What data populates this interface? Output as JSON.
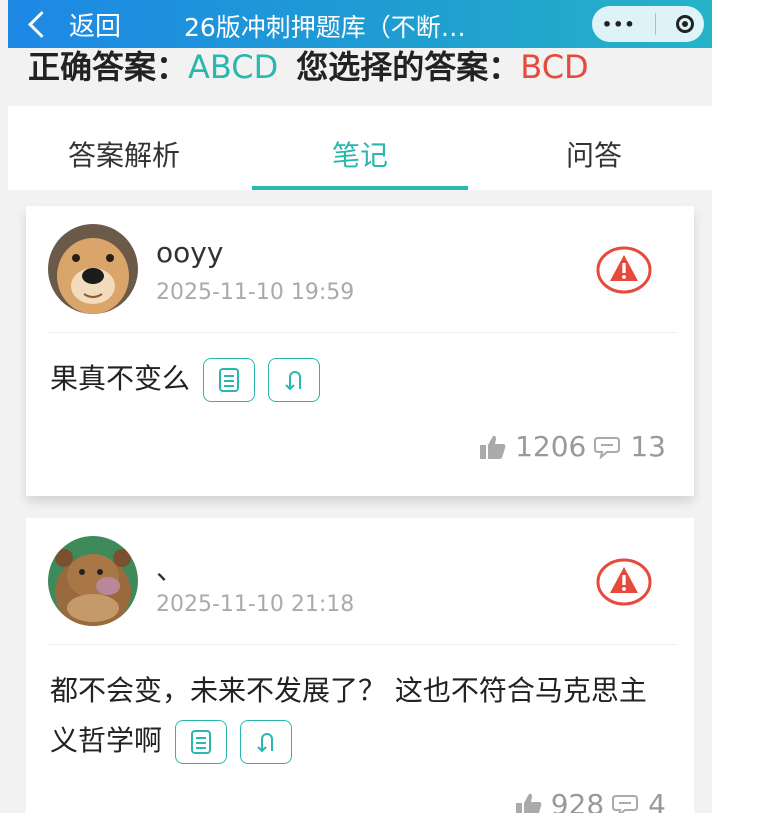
{
  "header": {
    "back_label": "返回",
    "title": "26版冲刺押题库（不断…"
  },
  "answer": {
    "correct_label": "正确答案：",
    "correct_value": "ABCD",
    "chosen_label": "您选择的答案：",
    "chosen_value": "BCD"
  },
  "tabs": [
    {
      "label": "答案解析",
      "active": false
    },
    {
      "label": "笔记",
      "active": true
    },
    {
      "label": "问答",
      "active": false
    }
  ],
  "notes": [
    {
      "username": "ooyy",
      "time": "2025-11-10 19:59",
      "content": "果真不变么",
      "likes": "1206",
      "comments": "13"
    },
    {
      "username": "、",
      "time": "2025-11-10 21:18",
      "content": "都不会变，未来不发展了？ 这也不符合马克思主义哲学啊",
      "likes": "928",
      "comments": "4"
    }
  ],
  "colors": {
    "accent": "#2ab7ae",
    "wrong": "#e64a3b",
    "header_start": "#1e88e5",
    "header_end": "#26b3c8"
  }
}
